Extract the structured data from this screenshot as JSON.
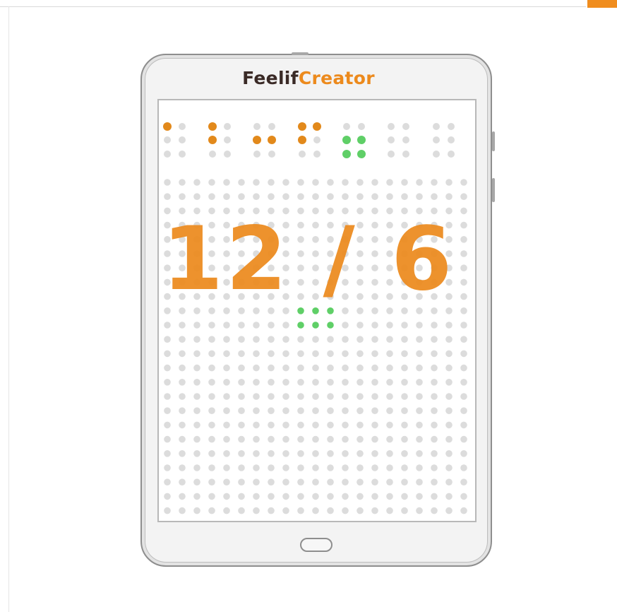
{
  "app": {
    "brand_part1": "Feelif",
    "brand_part2": "Creator"
  },
  "screen": {
    "expression": "12 / 6",
    "braille_orange_color": "#e2891b",
    "braille_green_color": "#5fcf67",
    "accent_color": "#ec8a1d"
  },
  "icons": {
    "home_button": "home-button-icon",
    "corner": "orange-corner-tab"
  }
}
